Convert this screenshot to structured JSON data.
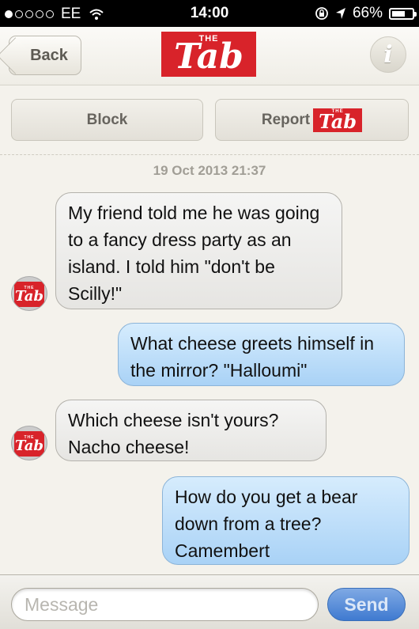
{
  "status": {
    "carrier": "EE",
    "time": "14:00",
    "battery_text": "66%",
    "battery_level": 0.66,
    "signal_bars_filled": 1,
    "signal_bars_total": 5
  },
  "nav": {
    "back_label": "Back",
    "logo_small": "THE",
    "logo_word": "Tab",
    "info_label": "i"
  },
  "actions": {
    "block_label": "Block",
    "report_label": "Report",
    "report_logo_small": "THE",
    "report_logo_word": "Tab"
  },
  "thread": {
    "timestamp": "19 Oct 2013 21:37",
    "avatar_small": "THE",
    "avatar_word": "Tab",
    "messages": [
      {
        "direction": "incoming",
        "text": "My friend told me he was going to a fancy dress party as an island. I told him \"don't be Scilly!\""
      },
      {
        "direction": "outgoing",
        "text": "What cheese greets himself in the mirror? \"Halloumi\""
      },
      {
        "direction": "incoming",
        "text": "Which cheese isn't yours? Nacho cheese!"
      },
      {
        "direction": "outgoing",
        "text": "How do you get a bear down from a tree? Camembert"
      }
    ]
  },
  "composer": {
    "placeholder": "Message",
    "send_label": "Send"
  },
  "colors": {
    "brand_red": "#d8232a",
    "outgoing_bubble": "#b8dbfa",
    "incoming_bubble": "#eeeeec",
    "send_button": "#4a82d4"
  }
}
